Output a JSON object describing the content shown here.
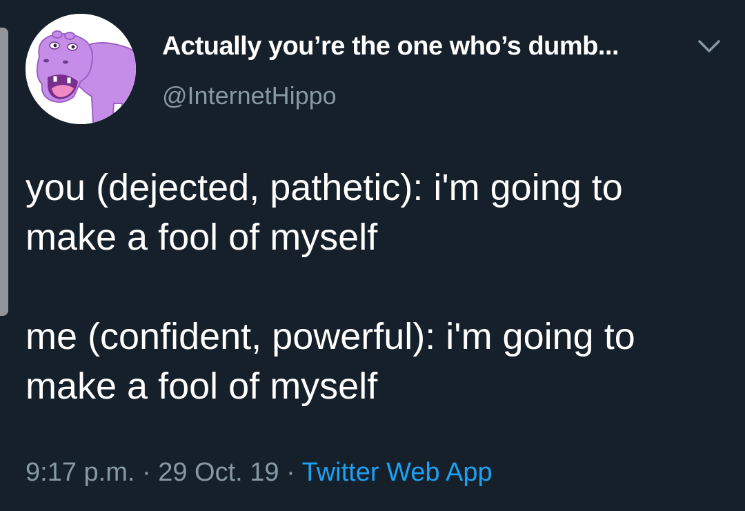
{
  "tweet": {
    "display_name": "Actually you’re the one who’s dumb...",
    "username": "@InternetHippo",
    "paragraphs": [
      "you (dejected, pathetic): i'm going to make a fool of myself",
      "me (confident, powerful): i'm going to make a fool of myself"
    ],
    "time": "9:17 p.m.",
    "separator_1": " · ",
    "date": "29 Oct. 19",
    "separator_2": " · ",
    "source": "Twitter Web App"
  },
  "icons": {
    "avatar": "hippo-avatar-icon",
    "menu": "chevron-down-icon"
  },
  "colors": {
    "background": "#15202b",
    "text": "#ffffff",
    "secondary_text": "#8899a6",
    "link": "#1da1f2",
    "avatar_hippo": "#c58de8"
  }
}
